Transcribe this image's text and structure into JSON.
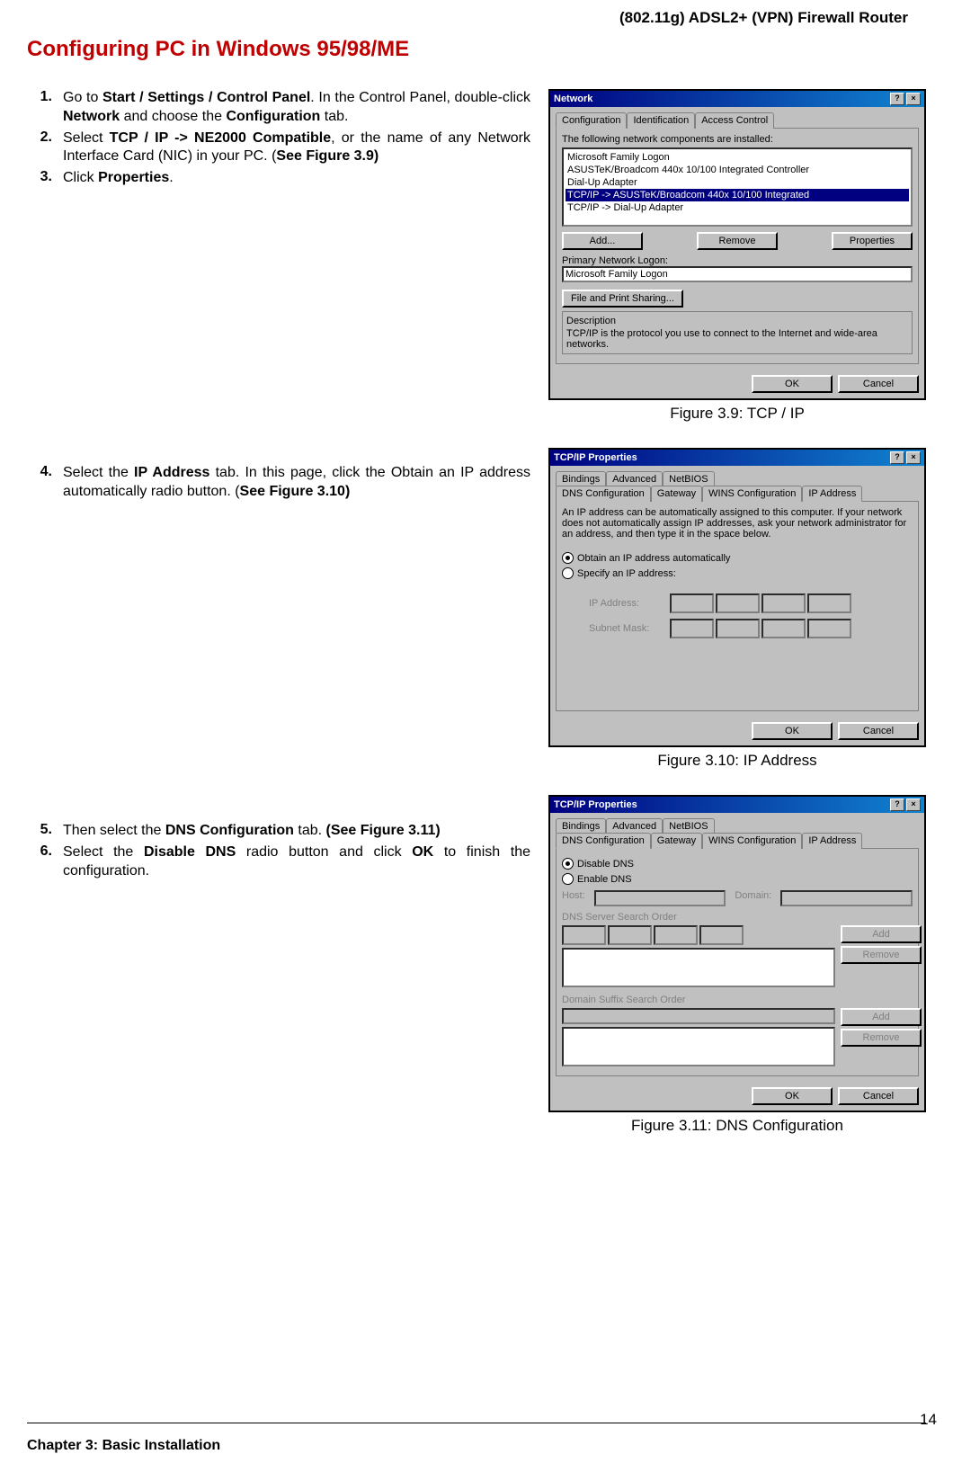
{
  "doc_header": "(802.11g) ADSL2+ (VPN) Firewall Router",
  "section_title": "Configuring PC in Windows 95/98/ME",
  "page_number": "14",
  "footer_chapter": "Chapter 3: Basic Installation",
  "steps": {
    "s1": {
      "n": "1.",
      "a": "Go to ",
      "b": "Start / Settings / Control Panel",
      "c": ". In the Control Panel, double-click ",
      "d": "Network",
      "e": " and choose the ",
      "f": "Configuration",
      "g": " tab."
    },
    "s2": {
      "n": "2.",
      "a": "Select ",
      "b": "TCP / IP -> NE2000 Compatible",
      "c": ", or the name of any Network Interface Card (NIC) in your PC. (",
      "d": "See Figure 3.9)",
      "e": ""
    },
    "s3": {
      "n": "3.",
      "a": "Click ",
      "b": "Properties",
      "c": "."
    },
    "s4": {
      "n": "4.",
      "a": "Select the ",
      "b": "IP Address",
      "c": " tab. In this page, click the Obtain an IP address automatically radio button. (",
      "d": "See Figure 3.10)",
      "e": ""
    },
    "s5": {
      "n": "5.",
      "a": "Then select the ",
      "b": "DNS Configuration",
      "c": " tab. ",
      "d": "(See Figure 3.11)",
      "e": ""
    },
    "s6": {
      "n": "6.",
      "a": "Select the ",
      "b": "Disable DNS",
      "c": " radio button and click ",
      "d": "OK",
      "e": " to finish the configuration."
    }
  },
  "fig1": {
    "caption": "Figure 3.9: TCP / IP",
    "title": "Network",
    "tabs": {
      "t1": "Configuration",
      "t2": "Identification",
      "t3": "Access Control"
    },
    "label_components": "The following network components are installed:",
    "items": {
      "i1": "Microsoft Family Logon",
      "i2": "ASUSTeK/Broadcom 440x 10/100 Integrated Controller",
      "i3": "Dial-Up Adapter",
      "i4": "TCP/IP -> ASUSTeK/Broadcom 440x 10/100 Integrated",
      "i5": "TCP/IP -> Dial-Up Adapter"
    },
    "btn_add": "Add...",
    "btn_remove": "Remove",
    "btn_prop": "Properties",
    "label_primary": "Primary Network Logon:",
    "primary_value": "Microsoft Family Logon",
    "btn_share": "File and Print Sharing...",
    "label_desc": "Description",
    "desc_text": "TCP/IP is the protocol you use to connect to the Internet and wide-area networks.",
    "ok": "OK",
    "cancel": "Cancel"
  },
  "fig2": {
    "caption": "Figure 3.10: IP Address",
    "title": "TCP/IP Properties",
    "tabs_row1": {
      "t1": "Bindings",
      "t2": "Advanced",
      "t3": "NetBIOS"
    },
    "tabs_row2": {
      "t1": "DNS Configuration",
      "t2": "Gateway",
      "t3": "WINS Configuration",
      "t4": "IP Address"
    },
    "intro": "An IP address can be automatically assigned to this computer. If your network does not automatically assign IP addresses, ask your network administrator for an address, and then type it in the space below.",
    "r1": "Obtain an IP address automatically",
    "r2": "Specify an IP address:",
    "lbl_ip": "IP Address:",
    "lbl_mask": "Subnet Mask:",
    "ok": "OK",
    "cancel": "Cancel"
  },
  "fig3": {
    "caption": "Figure 3.11: DNS Configuration",
    "title": "TCP/IP Properties",
    "tabs_row1": {
      "t1": "Bindings",
      "t2": "Advanced",
      "t3": "NetBIOS"
    },
    "tabs_row2": {
      "t1": "DNS Configuration",
      "t2": "Gateway",
      "t3": "WINS Configuration",
      "t4": "IP Address"
    },
    "r1": "Disable DNS",
    "r2": "Enable DNS",
    "lbl_host": "Host:",
    "lbl_domain": "Domain:",
    "lbl_dnssearch": "DNS Server Search Order",
    "lbl_suffix": "Domain Suffix Search Order",
    "btn_add": "Add",
    "btn_remove": "Remove",
    "ok": "OK",
    "cancel": "Cancel"
  }
}
